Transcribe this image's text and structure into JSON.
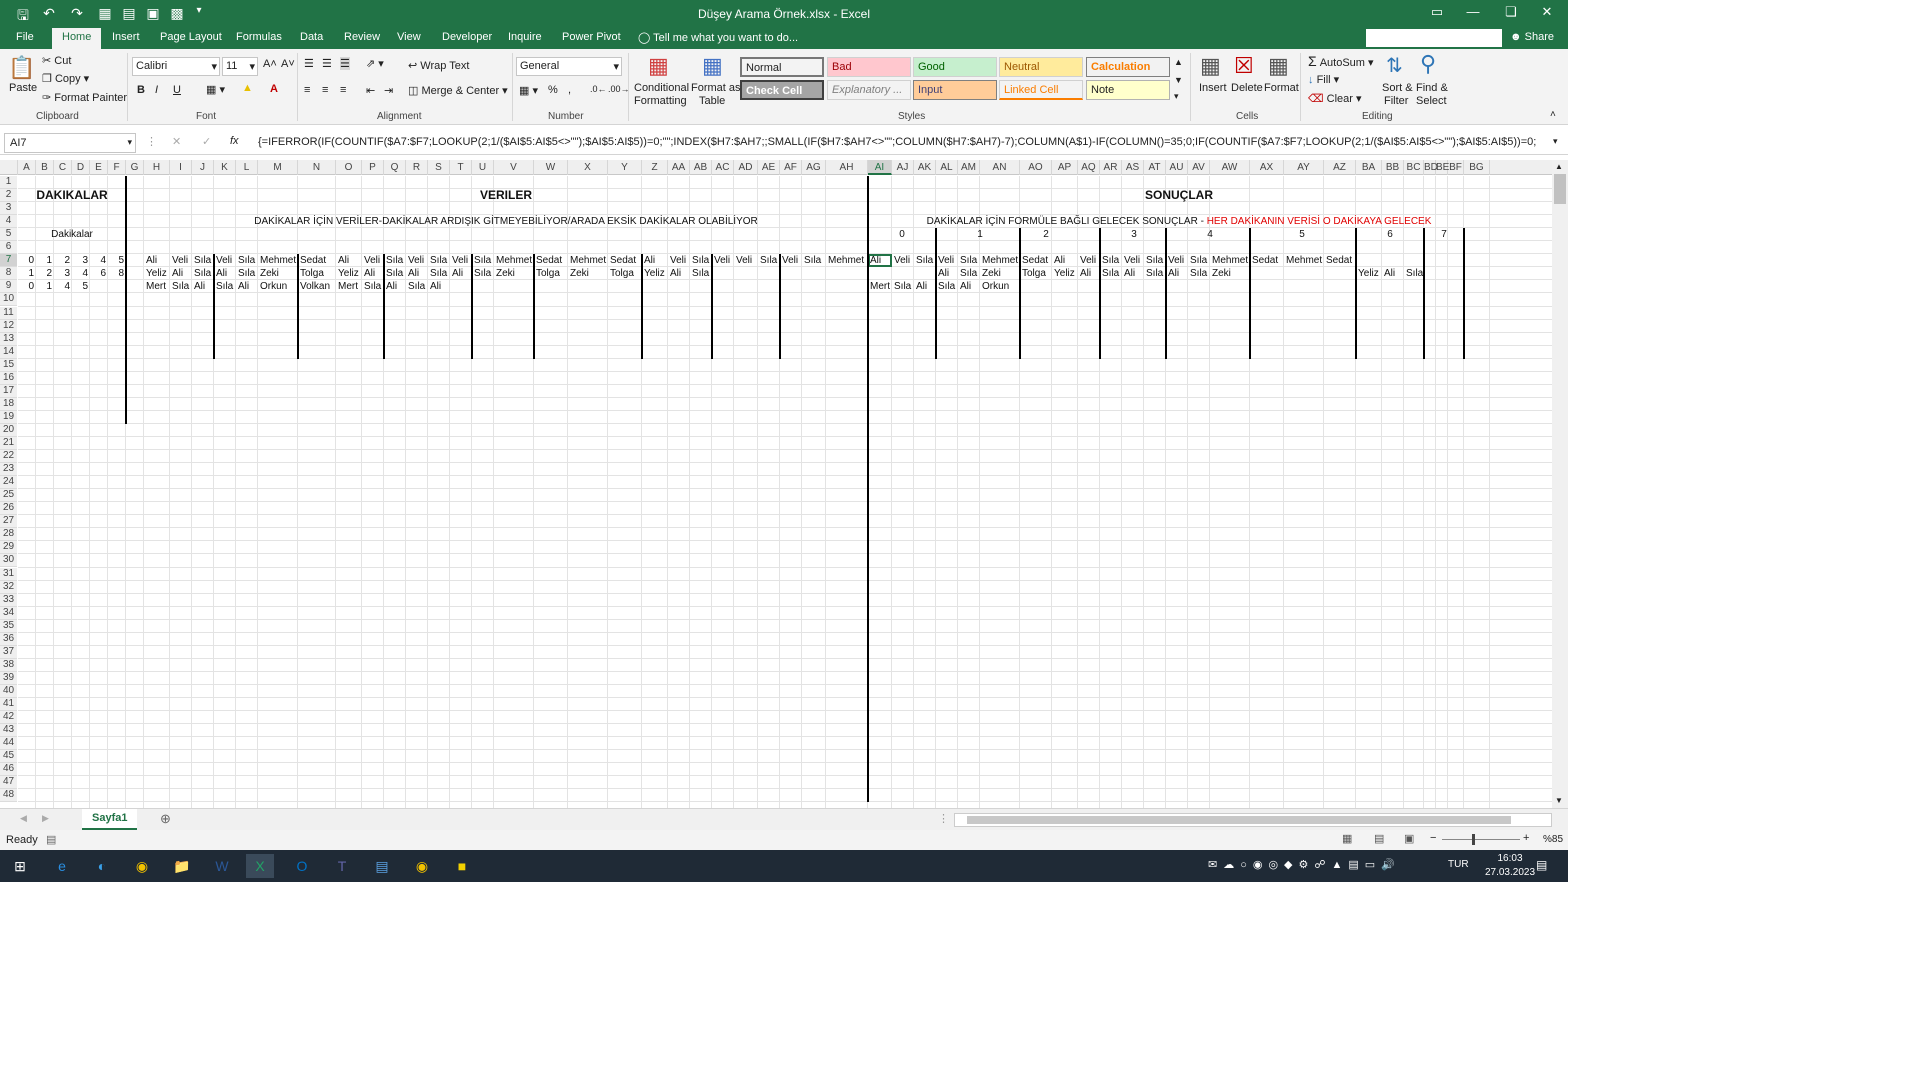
{
  "window": {
    "title": "Düşey Arama Örnek.xlsx - Excel"
  },
  "ribbon_tabs": [
    "File",
    "Home",
    "Insert",
    "Page Layout",
    "Formulas",
    "Data",
    "Review",
    "View",
    "Developer",
    "Inquire",
    "Power Pivot"
  ],
  "tell_me": "Tell me what you want to do...",
  "share": "Share",
  "clipboard": {
    "paste": "Paste",
    "cut": "Cut",
    "copy": "Copy",
    "format_painter": "Format Painter",
    "group": "Clipboard"
  },
  "font": {
    "name": "Calibri",
    "size": "11",
    "group": "Font",
    "bold": "B",
    "italic": "I",
    "underline": "U"
  },
  "alignment": {
    "wrap": "Wrap Text",
    "merge": "Merge & Center",
    "group": "Alignment"
  },
  "number": {
    "format": "General",
    "group": "Number"
  },
  "styles": {
    "conditional": "Conditional",
    "conditional2": "Formatting",
    "format_as": "Format as",
    "format_as2": "Table",
    "group": "Styles",
    "cells": [
      {
        "label": "Normal",
        "bg": "#ffffff",
        "fg": "#000000"
      },
      {
        "label": "Bad",
        "bg": "#ffc7ce",
        "fg": "#9c0006"
      },
      {
        "label": "Good",
        "bg": "#c6efce",
        "fg": "#006100"
      },
      {
        "label": "Neutral",
        "bg": "#ffeb9c",
        "fg": "#9c5700"
      },
      {
        "label": "Calculation",
        "bg": "#f2f2f2",
        "fg": "#fa7d00"
      },
      {
        "label": "Check Cell",
        "bg": "#a5a5a5",
        "fg": "#ffffff"
      },
      {
        "label": "Explanatory ...",
        "bg": "#ffffff",
        "fg": "#7f7f7f"
      },
      {
        "label": "Input",
        "bg": "#ffcc99",
        "fg": "#3f3f76"
      },
      {
        "label": "Linked Cell",
        "bg": "#ffffff",
        "fg": "#fa7d00"
      },
      {
        "label": "Note",
        "bg": "#ffffcc",
        "fg": "#000000"
      }
    ]
  },
  "cells_grp": {
    "insert": "Insert",
    "delete": "Delete",
    "format": "Format",
    "group": "Cells"
  },
  "editing": {
    "autosum": "AutoSum",
    "fill": "Fill",
    "clear": "Clear",
    "sort": "Sort &",
    "sort2": "Filter",
    "find": "Find &",
    "find2": "Select",
    "group": "Editing"
  },
  "formula_bar": {
    "name_box": "AI7",
    "fx": "fx",
    "formula": "{=IFERROR(IF(COUNTIF($A7:$F7;LOOKUP(2;1/($AI$5:AI$5<>\"\");$AI$5:AI$5))=0;\"\";INDEX($H7:$AH7;;SMALL(IF($H7:$AH7<>\"\";COLUMN($H7:$AH7)-7);COLUMN(A$1)-IF(COLUMN()=35;0;IF(COUNTIF($A7:$F7;LOOKUP(2;1/($AI$5:AI$5<>\"\");$AI$5:AI$5))=0;"
  },
  "columns": [
    "A",
    "B",
    "C",
    "D",
    "E",
    "F",
    "G",
    "H",
    "I",
    "J",
    "K",
    "L",
    "M",
    "N",
    "O",
    "P",
    "Q",
    "R",
    "S",
    "T",
    "U",
    "V",
    "W",
    "X",
    "Y",
    "Z",
    "AA",
    "AB",
    "AC",
    "AD",
    "AE",
    "AF",
    "AG",
    "AH",
    "AI",
    "AJ",
    "AK",
    "AL",
    "AM",
    "AN",
    "AO",
    "AP",
    "AQ",
    "AR",
    "AS",
    "AT",
    "AU",
    "AV",
    "AW",
    "AX",
    "AY",
    "AZ",
    "BA",
    "BB",
    "BC",
    "BD",
    "BE",
    "BF",
    "BG"
  ],
  "sheet": {
    "headers": {
      "dakikalar": "DAKIKALAR",
      "veriler": "VERILER",
      "sonuclar": "SONUÇLAR"
    },
    "row4_left": "DAKİKALAR İÇİN VERİLER-DAKİKALAR ARDIŞIK GİTMEYEBİLİYOR/ARADA EKSİK DAKİKALAR OLABİLİYOR",
    "row4_right_black": "DAKİKALAR İÇİN FORMÜLE BAĞLI GELECEK SONUÇLAR - ",
    "row4_right_red": "HER DAKİKANIN VERİSİ O DAKİKAYA GELECEK",
    "row5_label": "Dakikalar",
    "row5_minutes": [
      "0",
      "1",
      "2",
      "3",
      "4",
      "5",
      "6",
      "7"
    ],
    "row7_min": [
      "0",
      "1",
      "2",
      "3",
      "4",
      "5"
    ],
    "row8_min": [
      "1",
      "2",
      "3",
      "4",
      "6",
      "8"
    ],
    "row9_min": [
      "0",
      "1",
      "4",
      "5"
    ],
    "row7_data": [
      "Ali",
      "Veli",
      "Sıla",
      "Veli",
      "Sıla",
      "Mehmet",
      "Sedat",
      "Ali",
      "Veli",
      "Sıla",
      "Veli",
      "Sıla",
      "Veli",
      "Sıla",
      "Mehmet",
      "Sedat",
      "Mehmet",
      "Sedat",
      "Ali",
      "Veli",
      "Sıla",
      "Veli",
      "Veli",
      "Sıla",
      "Veli",
      "Sıla",
      "Mehmet"
    ],
    "row8_data": [
      "Yeliz",
      "Ali",
      "Sıla",
      "Ali",
      "Sıla",
      "Zeki",
      "Tolga",
      "Yeliz",
      "Ali",
      "Sıla",
      "Ali",
      "Sıla",
      "Ali",
      "Sıla",
      "Zeki",
      "Tolga",
      "Zeki",
      "Tolga",
      "Yeliz",
      "Ali",
      "Sıla"
    ],
    "row9_data": [
      "Mert",
      "Sıla",
      "Ali",
      "Sıla",
      "Ali",
      "Orkun",
      "Volkan",
      "Mert",
      "Sıla",
      "Ali",
      "Sıla",
      "Ali"
    ],
    "row7_res": [
      "Ali",
      "Veli",
      "Sıla",
      "Veli",
      "Sıla",
      "Mehmet",
      "Sedat",
      "Ali",
      "Veli",
      "Sıla",
      "Veli",
      "Sıla",
      "Veli",
      "Sıla",
      "Mehmet",
      "Sedat",
      "Mehmet",
      "Sedat"
    ],
    "row8_res": [
      "Ali",
      "Sıla",
      "Zeki",
      "Tolga",
      "Yeliz",
      "Ali",
      "Sıla",
      "Ali",
      "Sıla",
      "Ali",
      "Sıla",
      "Zeki",
      "Yeliz",
      "Ali",
      "Sıla"
    ],
    "row9_res": [
      "Mert",
      "Sıla",
      "Ali",
      "Sıla",
      "Ali",
      "Orkun"
    ]
  },
  "sheet_tab": "Sayfa1",
  "status": {
    "ready": "Ready",
    "zoom": "%85"
  },
  "clock": {
    "time": "16:03",
    "date": "27.03.2023",
    "lang": "TUR"
  }
}
